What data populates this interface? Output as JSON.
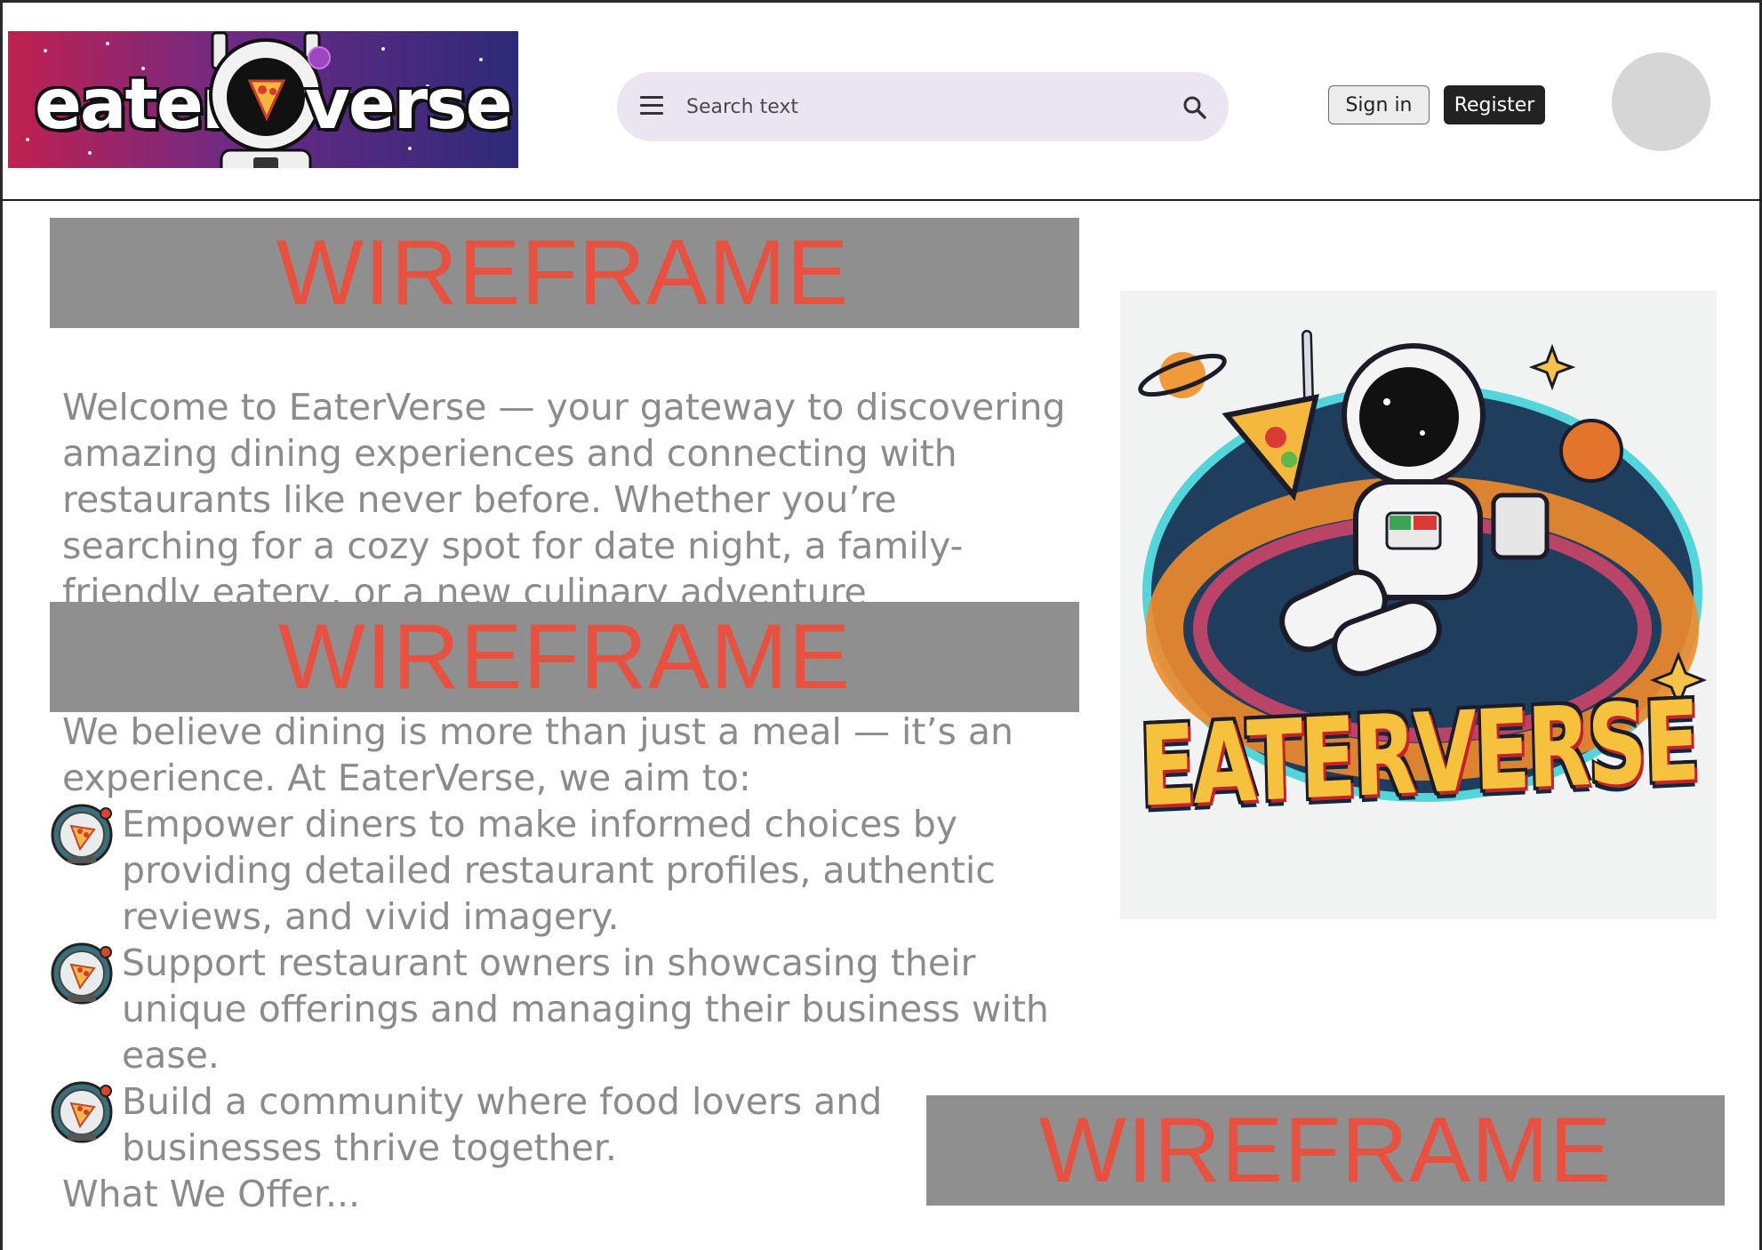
{
  "header": {
    "logo": {
      "text_left": "eater",
      "text_right": "verse"
    },
    "search": {
      "placeholder": "Search text"
    },
    "sign_in_label": "Sign in",
    "register_label": "Register"
  },
  "wireframes": [
    "WIREFRAME",
    "WIREFRAME",
    "WIREFRAME"
  ],
  "content": {
    "intro": "Welcome to EaterVerse — your gateway to discovering amazing dining experiences and connecting with restaurants like never before. Whether you’re searching for a cozy spot for date night, a family-friendly eatery, or a new culinary adventure",
    "belief": "We believe dining is more than just a meal — it’s an experience. At EaterVerse, we aim to:",
    "bullets": [
      "Empower diners to make informed choices by providing detailed restaurant profiles, authentic reviews, and vivid imagery.",
      "Support restaurant owners in showcasing their unique offerings and managing their business with ease.",
      "Build a community where food lovers and businesses thrive together."
    ],
    "offer_heading": "What We Offer..."
  },
  "hero": {
    "title": "EATERVERSE"
  },
  "colors": {
    "wireframe_bg": "#8f8f8f",
    "wireframe_text": "#e8503f",
    "body_text": "#8b8b8b",
    "search_bg": "#ebe5f1",
    "register_bg": "#222222"
  },
  "icons": [
    "menu-icon",
    "search-icon",
    "astronaut-pizza-icon"
  ]
}
